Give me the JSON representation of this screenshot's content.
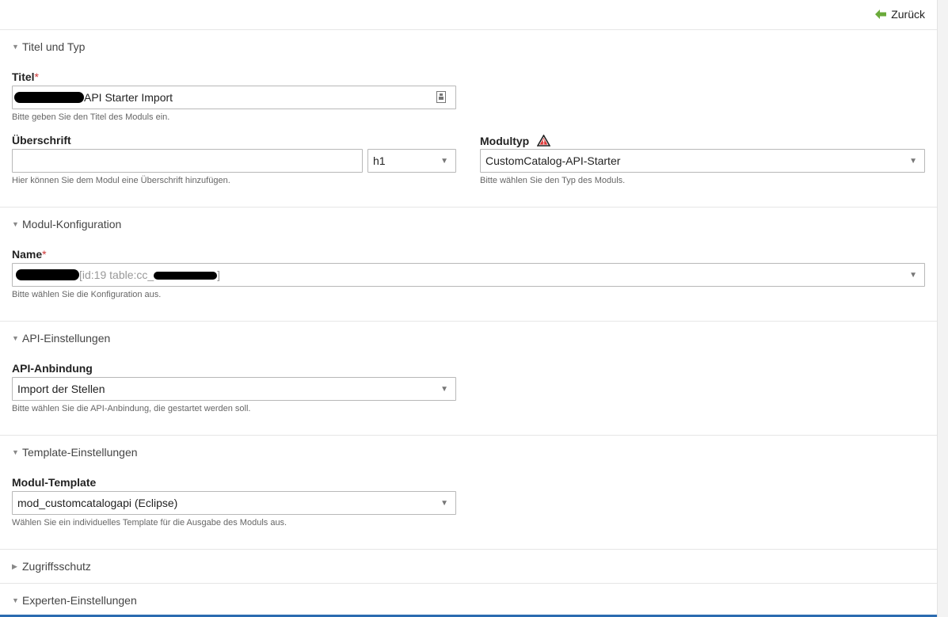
{
  "header": {
    "back_label": "Zurück"
  },
  "sections": {
    "titel_typ": "Titel und Typ",
    "modul_konfiguration": "Modul-Konfiguration",
    "api_einstellungen": "API-Einstellungen",
    "template_einstellungen": "Template-Einstellungen",
    "zugriffsschutz": "Zugriffsschutz",
    "experten_einstellungen": "Experten-Einstellungen"
  },
  "titel": {
    "label": "Titel",
    "required_mark": "*",
    "value_suffix": "API Starter Import",
    "help": "Bitte geben Sie den Titel des Moduls ein."
  },
  "ueberschrift": {
    "label": "Überschrift",
    "value": "",
    "level": "h1",
    "help": "Hier können Sie dem Modul eine Überschrift hinzufügen."
  },
  "modultyp": {
    "label": "Modultyp",
    "value": "CustomCatalog-API-Starter",
    "help": "Bitte wählen Sie den Typ des Moduls."
  },
  "name": {
    "label": "Name",
    "required_mark": "*",
    "value_middle": "[id:19 table:cc_",
    "value_end": "]",
    "help": "Bitte wählen Sie die Konfiguration aus."
  },
  "api_anbindung": {
    "label": "API-Anbindung",
    "value": "Import der Stellen",
    "help": "Bitte wählen Sie die API-Anbindung, die gestartet werden soll."
  },
  "modul_template": {
    "label": "Modul-Template",
    "value": "mod_customcatalogapi (Eclipse)",
    "help": "Wählen Sie ein individuelles Template für die Ausgabe des Moduls aus."
  },
  "icons": {
    "back": "arrow-left-icon",
    "collapse": "triangle-down-icon",
    "expand": "triangle-right-icon",
    "dropdown": "chevron-down-icon",
    "picker": "page-picker-icon",
    "warning": "warning-icon"
  },
  "colors": {
    "accent_green": "#6aaa3a",
    "required_red": "#cc3333",
    "bottom_blue": "#2b6bb0"
  }
}
